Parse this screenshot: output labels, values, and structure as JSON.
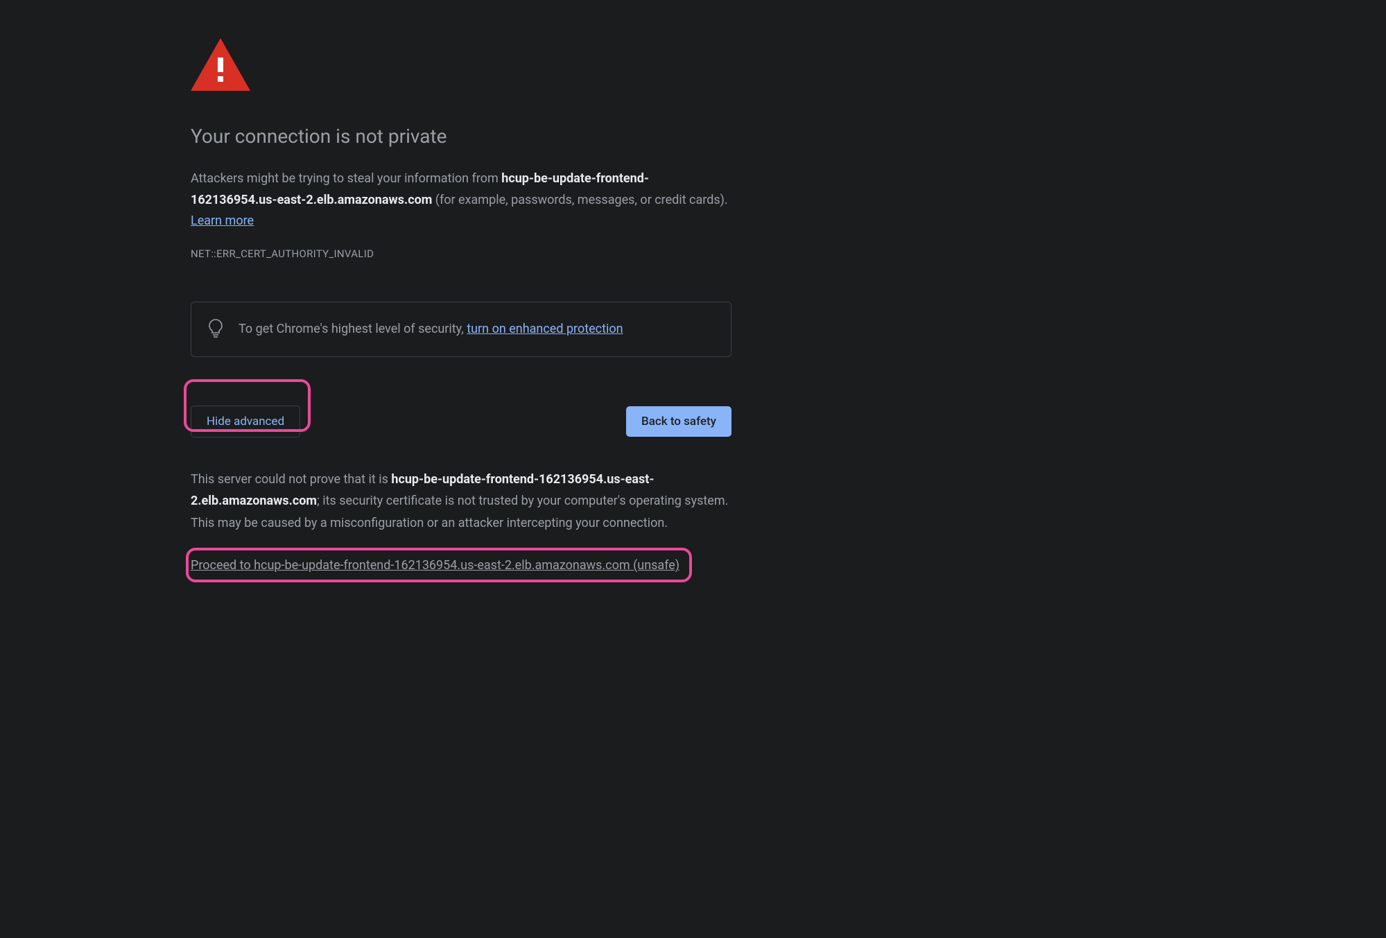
{
  "title": "Your connection is not private",
  "description": {
    "prefix": "Attackers might be trying to steal your information from ",
    "domain": "hcup-be-update-frontend-162136954.us-east-2.elb.amazonaws.com",
    "suffix": " (for example, passwords, messages, or credit cards). ",
    "learn_more": "Learn more"
  },
  "error_code": "NET::ERR_CERT_AUTHORITY_INVALID",
  "info_box": {
    "prefix": "To get Chrome's highest level of security, ",
    "link": "turn on enhanced protection"
  },
  "buttons": {
    "hide_advanced": "Hide advanced",
    "back_to_safety": "Back to safety"
  },
  "advanced": {
    "prefix": "This server could not prove that it is ",
    "domain": "hcup-be-update-frontend-162136954.us-east-2.elb.amazonaws.com",
    "suffix": "; its security certificate is not trusted by your computer's operating system. This may be caused by a misconfiguration or an attacker intercepting your connection."
  },
  "proceed_link": "Proceed to hcup-be-update-frontend-162136954.us-east-2.elb.amazonaws.com (unsafe)",
  "colors": {
    "bg": "#1a1c1e",
    "text": "#9aa0a6",
    "strong_text": "#e8eaed",
    "link": "#8ab4f8",
    "primary_btn_bg": "#8ab4f8",
    "primary_btn_text": "#202124",
    "border": "#3c4043",
    "warning_red": "#d93025",
    "highlight_pink": "#ec4899"
  },
  "icons": {
    "warning": "warning-triangle-icon",
    "bulb": "lightbulb-icon"
  }
}
